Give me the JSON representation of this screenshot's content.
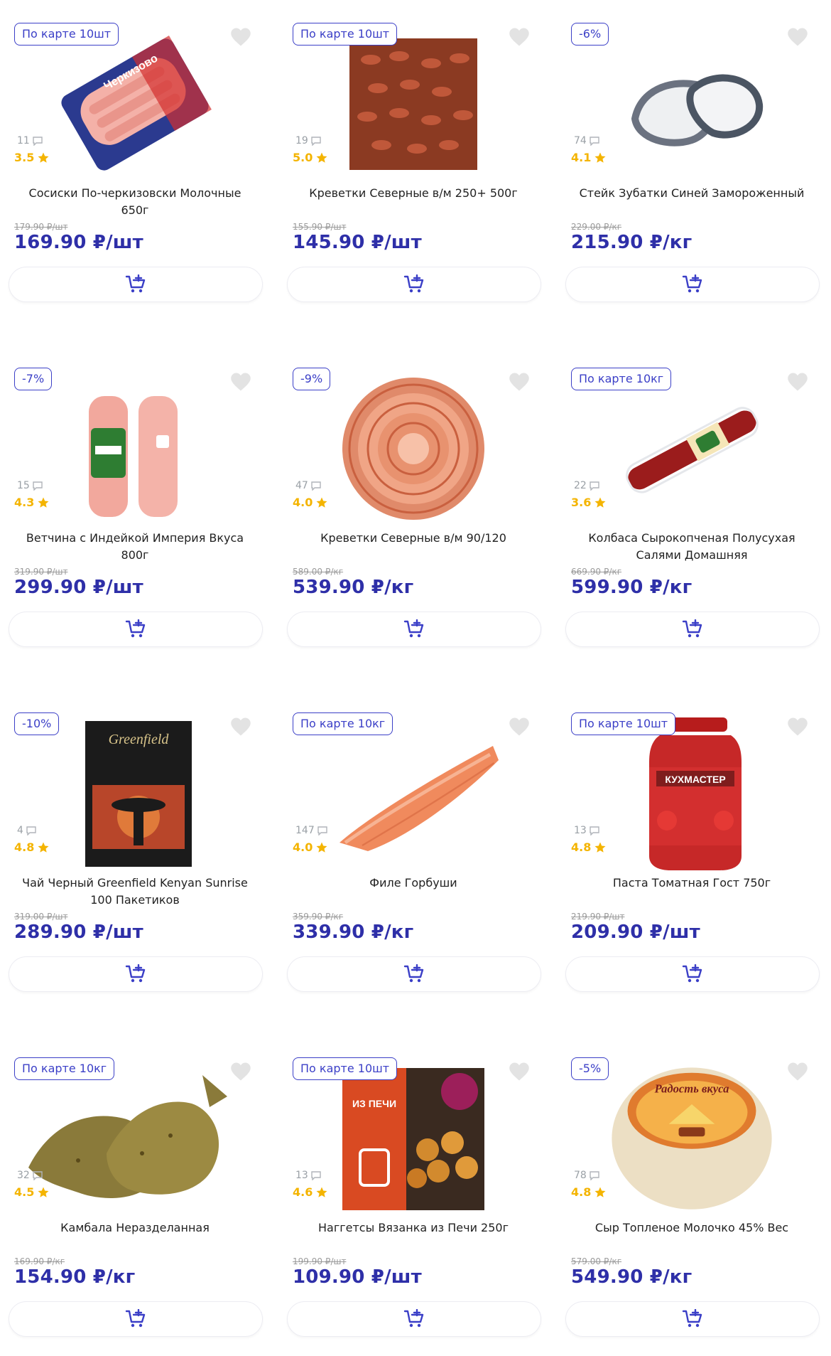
{
  "colors": {
    "accent": "#2e2fa8",
    "badge": "#3b3fc7",
    "star": "#f4b400"
  },
  "products": [
    {
      "badge": "По карте 10шт",
      "reviews": "11",
      "rating": "3.5",
      "name": "Сосиски По-черкизовски Молочные 650г",
      "old_price": "179.90 ₽/шт",
      "price": "169.90 ₽/шт"
    },
    {
      "badge": "По карте 10шт",
      "reviews": "19",
      "rating": "5.0",
      "name": "Креветки Северные в/м 250+ 500г",
      "old_price": "155.90 ₽/шт",
      "price": "145.90 ₽/шт"
    },
    {
      "badge": "-6%",
      "reviews": "74",
      "rating": "4.1",
      "name": "Стейк Зубатки Синей Замороженный",
      "old_price": "229.00 ₽/кг",
      "price": "215.90 ₽/кг"
    },
    {
      "badge": "-7%",
      "reviews": "15",
      "rating": "4.3",
      "name": "Ветчина с Индейкой Империя Вкуса 800г",
      "old_price": "319.90 ₽/шт",
      "price": "299.90 ₽/шт"
    },
    {
      "badge": "-9%",
      "reviews": "47",
      "rating": "4.0",
      "name": "Креветки Северные в/м 90/120",
      "old_price": "589.00 ₽/кг",
      "price": "539.90 ₽/кг"
    },
    {
      "badge": "По карте 10кг",
      "reviews": "22",
      "rating": "3.6",
      "name": "Колбаса Сырокопченая Полусухая Салями Домашняя",
      "old_price": "669.90 ₽/кг",
      "price": "599.90 ₽/кг"
    },
    {
      "badge": "-10%",
      "reviews": "4",
      "rating": "4.8",
      "name": "Чай Черный Greenfield Kenyan Sunrise 100 Пакетиков",
      "old_price": "319.00 ₽/шт",
      "price": "289.90 ₽/шт"
    },
    {
      "badge": "По карте 10кг",
      "reviews": "147",
      "rating": "4.0",
      "name": "Филе Горбуши",
      "old_price": "359.90 ₽/кг",
      "price": "339.90 ₽/кг"
    },
    {
      "badge": "По карте 10шт",
      "reviews": "13",
      "rating": "4.8",
      "name": "Паста Томатная Гост 750г",
      "old_price": "219.90 ₽/шт",
      "price": "209.90 ₽/шт"
    },
    {
      "badge": "По карте 10кг",
      "reviews": "32",
      "rating": "4.5",
      "name": "Камбала Неразделанная",
      "old_price": "169.90 ₽/кг",
      "price": "154.90 ₽/кг"
    },
    {
      "badge": "По карте 10шт",
      "reviews": "13",
      "rating": "4.6",
      "name": "Наггетсы Вязанка из Печи 250г",
      "old_price": "199.90 ₽/шт",
      "price": "109.90 ₽/шт"
    },
    {
      "badge": "-5%",
      "reviews": "78",
      "rating": "4.8",
      "name": "Сыр Топленое Молочко 45% Вес",
      "old_price": "579.00 ₽/кг",
      "price": "549.90 ₽/кг"
    }
  ],
  "product_images": [
    {
      "icon": "sausage-pack-image",
      "label": "Черкизово"
    },
    {
      "icon": "shrimp-box-image",
      "label": ""
    },
    {
      "icon": "fish-steak-image",
      "label": ""
    },
    {
      "icon": "ham-image",
      "label": ""
    },
    {
      "icon": "shrimp-plate-image",
      "label": ""
    },
    {
      "icon": "salami-image",
      "label": ""
    },
    {
      "icon": "tea-box-image",
      "label": "Greenfield"
    },
    {
      "icon": "salmon-fillet-image",
      "label": ""
    },
    {
      "icon": "tomato-paste-jar-image",
      "label": "КУХМАСТЕР"
    },
    {
      "icon": "flatfish-image",
      "label": ""
    },
    {
      "icon": "nuggets-box-image",
      "label": "ИЗ ПЕЧИ"
    },
    {
      "icon": "cheese-wheel-image",
      "label": "Радость вкуса"
    }
  ]
}
